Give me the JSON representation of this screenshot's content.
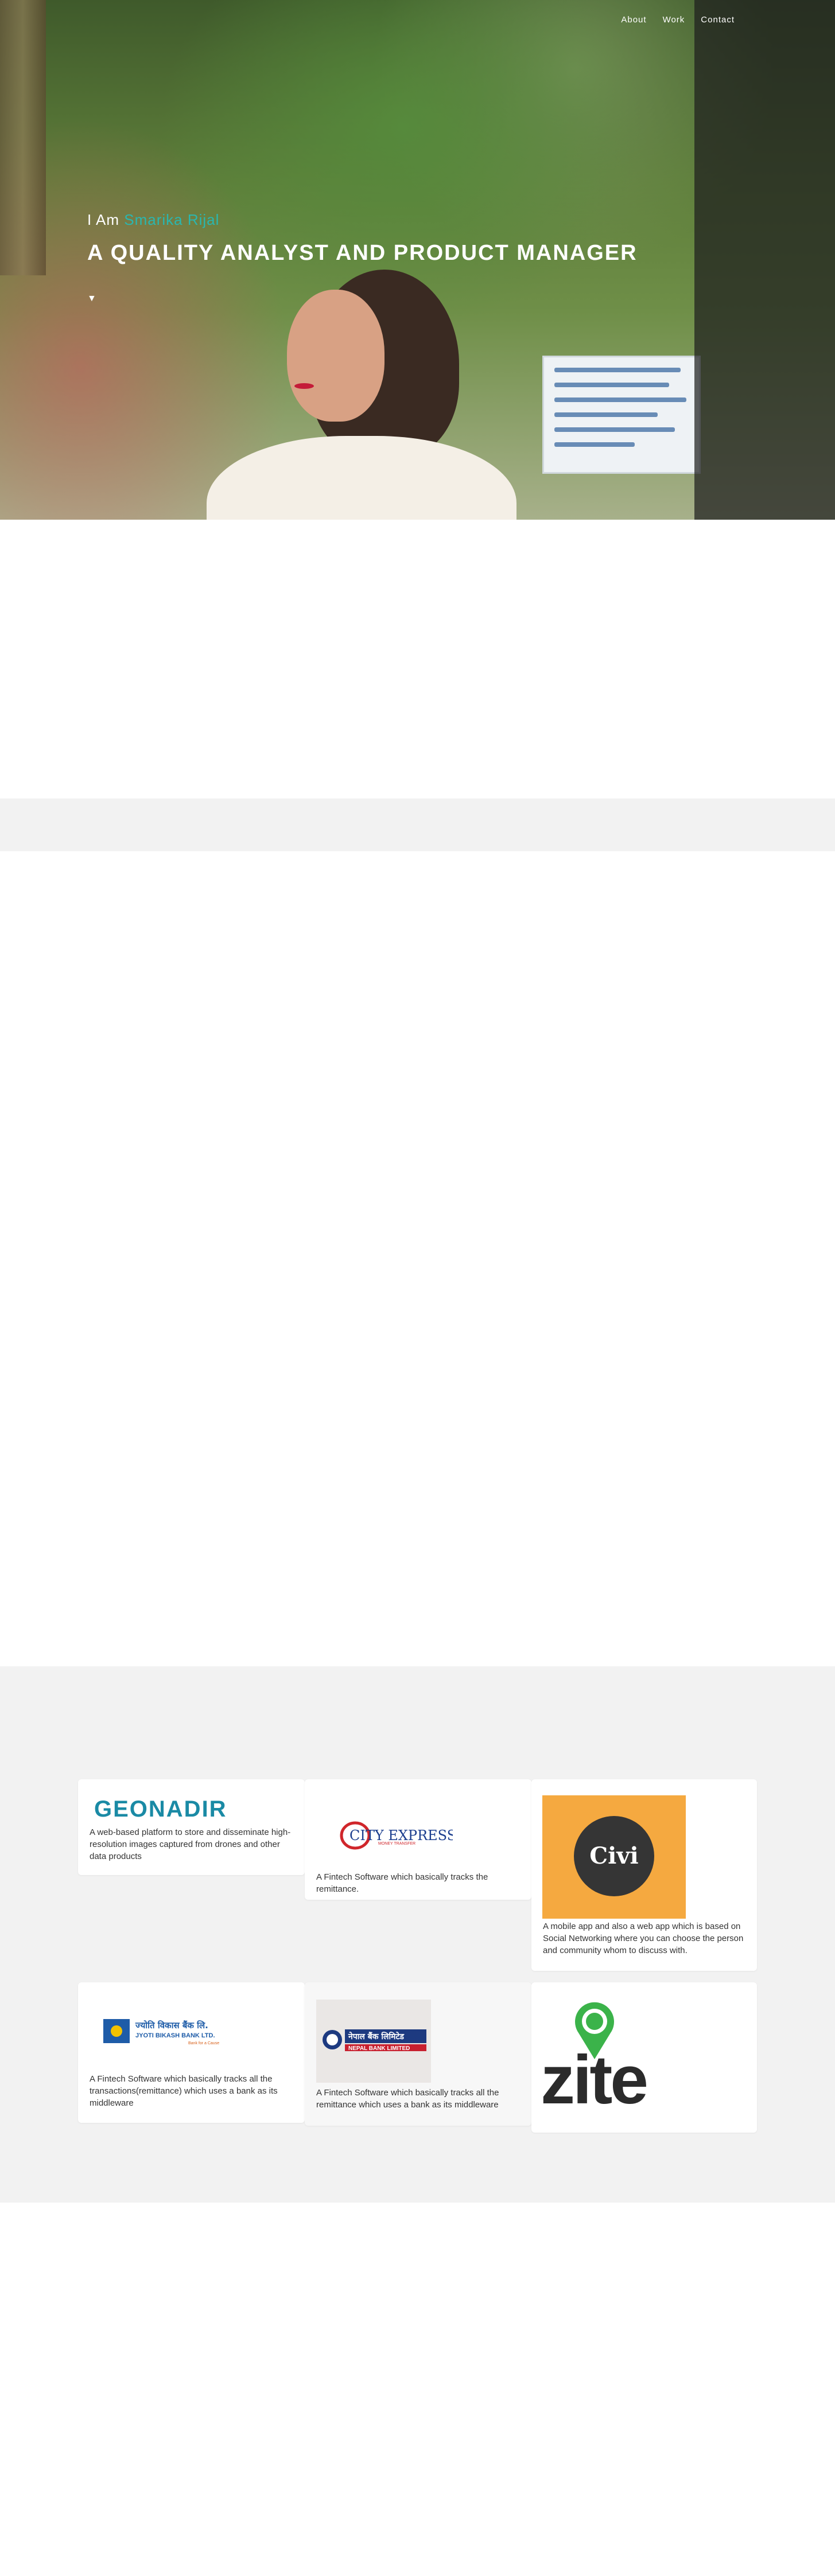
{
  "nav": {
    "items": [
      "About",
      "Work",
      "Contact"
    ]
  },
  "hero": {
    "intro_prefix": "I Am",
    "name": "Smarika Rijal",
    "headline": "A QUALITY ANALYST AND PRODUCT MANAGER",
    "scroll_mark": "▼"
  },
  "colors": {
    "accent": "#2ab7b0",
    "section_gray": "#f2f2f2",
    "civi_orange": "#f5a940"
  },
  "work": {
    "projects": [
      {
        "logo_text": "GEONADIR",
        "description": "A web-based platform to store and disseminate high-resolution images captured from drones and other data products"
      },
      {
        "logo_text": "CITY EXPRESS",
        "logo_tagline": "MONEY TRANSFER",
        "description": "A Fintech Software which basically tracks the remittance."
      },
      {
        "logo_text": "Civi",
        "description": "A mobile app and also a web app which is based on Social Networking where you can choose the person and community whom to discuss with."
      },
      {
        "logo_text": "ज्योति विकास बैंक लि.",
        "logo_subtext": "JYOTI BIKASH BANK LTD.",
        "logo_tagline": "Bank for a Cause",
        "description": "A Fintech Software which basically tracks all the transactions(remittance) which uses a bank as its middleware"
      },
      {
        "logo_text": "नेपाल बैंक लिमिटेड",
        "logo_subtext": "NEPAL BANK LIMITED",
        "description": "A Fintech Software which basically tracks all the remittance which uses a bank as its middleware"
      },
      {
        "logo_text": "zite"
      }
    ]
  }
}
